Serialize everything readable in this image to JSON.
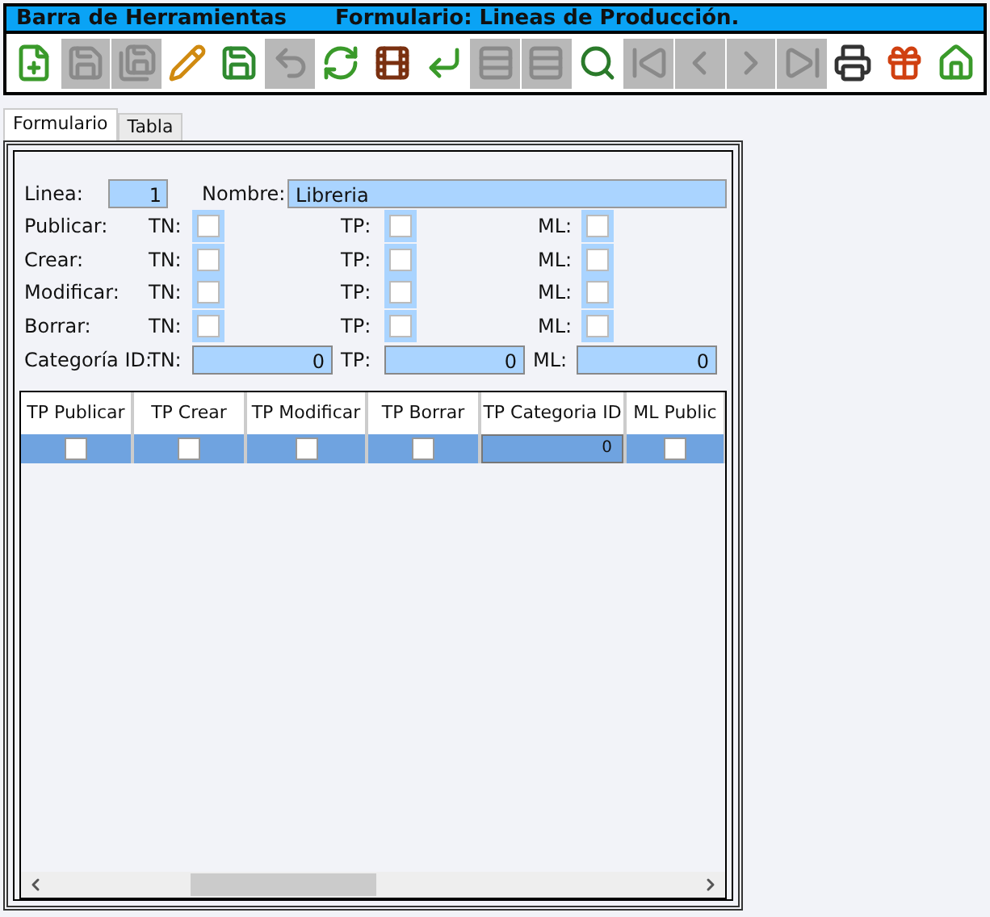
{
  "title_bar": {
    "toolbar_title": "Barra de Herramientas",
    "form_title": "Formulario: Lineas de Producción."
  },
  "toolbar": [
    {
      "kind": "new",
      "disabled": false
    },
    {
      "kind": "save",
      "disabled": true
    },
    {
      "kind": "save-as",
      "disabled": true
    },
    {
      "kind": "edit",
      "disabled": false
    },
    {
      "kind": "cancel-save",
      "disabled": false
    },
    {
      "kind": "undo",
      "disabled": true
    },
    {
      "kind": "refresh",
      "disabled": false
    },
    {
      "kind": "film",
      "disabled": false
    },
    {
      "kind": "reply",
      "disabled": false
    },
    {
      "kind": "add-row",
      "disabled": true
    },
    {
      "kind": "remove-row",
      "disabled": true
    },
    {
      "kind": "search",
      "disabled": false
    },
    {
      "kind": "first",
      "disabled": true
    },
    {
      "kind": "prev",
      "disabled": true
    },
    {
      "kind": "next",
      "disabled": true
    },
    {
      "kind": "last",
      "disabled": true
    },
    {
      "kind": "print",
      "disabled": false
    },
    {
      "kind": "gift",
      "disabled": false
    },
    {
      "kind": "home",
      "disabled": false
    }
  ],
  "tabs": [
    {
      "label": "Formulario",
      "selected": true
    },
    {
      "label": "Tabla",
      "selected": false
    }
  ],
  "form": {
    "linea_label": "Linea:",
    "linea_value": "1",
    "nombre_label": "Nombre:",
    "nombre_value": "Libreria",
    "check_rows": [
      {
        "label": "Publicar:",
        "items": [
          {
            "label": "TN:",
            "checked": false
          },
          {
            "label": "TP:",
            "checked": false
          },
          {
            "label": "ML:",
            "checked": false
          }
        ]
      },
      {
        "label": "Crear:",
        "items": [
          {
            "label": "TN:",
            "checked": false
          },
          {
            "label": "TP:",
            "checked": false
          },
          {
            "label": "ML:",
            "checked": false
          }
        ]
      },
      {
        "label": "Modificar:",
        "items": [
          {
            "label": "TN:",
            "checked": false
          },
          {
            "label": "TP:",
            "checked": false
          },
          {
            "label": "ML:",
            "checked": false
          }
        ]
      },
      {
        "label": "Borrar:",
        "items": [
          {
            "label": "TN:",
            "checked": false
          },
          {
            "label": "TP:",
            "checked": false
          },
          {
            "label": "ML:",
            "checked": false
          }
        ]
      }
    ],
    "category_row": {
      "label": "Categoría ID:",
      "items": [
        {
          "label": "TN:",
          "value": "0"
        },
        {
          "label": "TP:",
          "value": "0"
        },
        {
          "label": "ML:",
          "value": "0"
        }
      ]
    }
  },
  "table": {
    "columns": [
      "TP Publicar",
      "TP Crear",
      "TP Modificar",
      "TP Borrar",
      "TP Categoria ID",
      "ML Public"
    ],
    "rows": [
      {
        "selected": true,
        "cells": [
          {
            "kind": "check",
            "checked": false
          },
          {
            "kind": "check",
            "checked": false
          },
          {
            "kind": "check",
            "checked": false
          },
          {
            "kind": "check",
            "checked": false
          },
          {
            "kind": "number",
            "value": "0"
          },
          {
            "kind": "check",
            "checked": false
          }
        ]
      }
    ]
  }
}
